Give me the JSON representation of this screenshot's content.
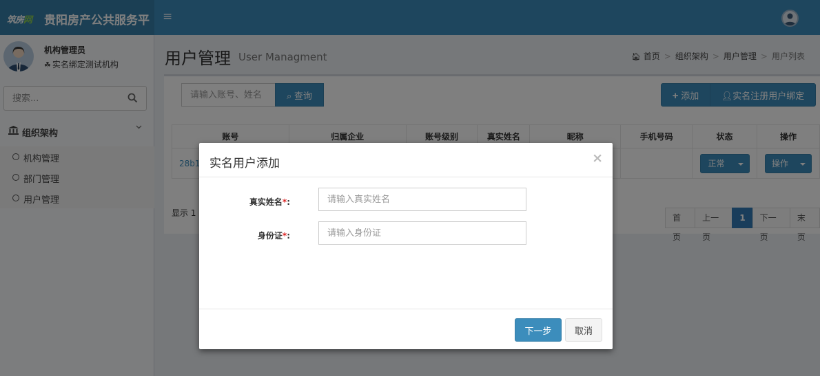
{
  "header": {
    "logo_part1": "筑房",
    "logo_part2": "网",
    "title": "贵阳房产公共服务平",
    "menu_toggle": "≡"
  },
  "sidebar": {
    "user_name": "机构管理员",
    "user_org": "实名绑定测试机构",
    "search_placeholder": "搜索...",
    "section_label": "组织架构",
    "items": [
      {
        "label": "机构管理"
      },
      {
        "label": "部门管理"
      },
      {
        "label": "用户管理"
      }
    ]
  },
  "page": {
    "title": "用户管理",
    "subtitle": "User Managment",
    "breadcrumb": [
      "首页",
      "组织架构",
      "用户管理",
      "用户列表"
    ],
    "search_placeholder": "请输入账号、姓名",
    "query_button": "查询",
    "add_button": "添加",
    "bind_button": "实名注册用户绑定"
  },
  "table": {
    "columns": [
      "账号",
      "归属企业",
      "账号级别",
      "真实姓名",
      "昵称",
      "手机号码",
      "状态",
      "操作"
    ],
    "rows": [
      {
        "account": "28b1",
        "status": "正常",
        "action": "操作"
      }
    ]
  },
  "footer": {
    "showing_text": "显示 1 ",
    "pagination": [
      "首页",
      "上一页",
      "1",
      "下一页",
      "末页"
    ]
  },
  "modal": {
    "title": "实名用户添加",
    "close": "×",
    "fields": [
      {
        "label": "真实姓名",
        "required_mark": "*",
        "colon": ":",
        "placeholder": "请输入真实姓名"
      },
      {
        "label": "身份证",
        "required_mark": "*",
        "colon": ":",
        "placeholder": "请输入身份证"
      }
    ],
    "next_button": "下一步",
    "cancel_button": "取消"
  },
  "colors": {
    "topbar": "#3c8dbc",
    "brand": "#367fa9",
    "primary_button": "#3c8dbc",
    "required": "#dd2222"
  },
  "icons": [
    "bars-icon",
    "user-avatar-icon",
    "users-icon",
    "search-icon",
    "bank-icon",
    "chevron-down-icon",
    "circle-icon",
    "home-icon",
    "plus-icon",
    "user-outline-icon",
    "caret-down-icon",
    "close-icon"
  ]
}
